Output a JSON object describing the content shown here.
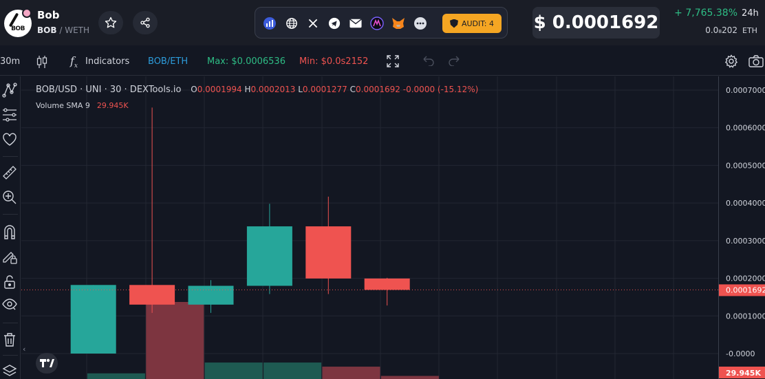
{
  "header": {
    "token_name": "Bob",
    "logo_text": "BOB",
    "base_symbol": "BOB",
    "separator": "/",
    "quote_symbol": "WETH",
    "favorite_icon": "star-icon",
    "share_icon": "share-icon",
    "social_icons": [
      "chart-icon",
      "globe-icon",
      "x-icon",
      "telegram-icon",
      "email-icon",
      "dapp-icon",
      "metamask-icon",
      "more-icon"
    ],
    "audit_label": "AUDIT: 4",
    "price": "$ 0.0001692",
    "change": "+ 7,765.38%",
    "change_period": "24h",
    "eth_price": "0.0₈202",
    "eth_unit": "ETH",
    "colors": {
      "up": "#26a69a",
      "down": "#ef5350",
      "audit": "#f5a623",
      "link": "#2d9cdb"
    }
  },
  "toolbar": {
    "interval": "30m",
    "indicators_label": "Indicators",
    "pair_label": "BOB/ETH",
    "max_label": "Max: $0.0006536",
    "min_label": "Min: $0.0s2152"
  },
  "chart_legend": {
    "title": "BOB/USD · UNI · 30 · DEXTools.io",
    "o_key": "O",
    "o_val": "0.0001994",
    "h_key": "H",
    "h_val": "0.0002013",
    "l_key": "L",
    "l_val": "0.0001277",
    "c_key": "C",
    "c_val": "0.0001692",
    "chg": "-0.0000 (-15.12%)",
    "volume_label": "Volume SMA 9",
    "volume_value": "29.945K"
  },
  "left_tools": [
    "crosshair-icon",
    "trend-line-icon",
    "fib-icon",
    "heart-icon",
    "ruler-icon",
    "zoom-in-icon",
    "magnet-icon",
    "lock-drawing-icon",
    "lock-icon",
    "eye-icon",
    "trash-icon",
    "layers-icon"
  ],
  "chart_data": {
    "type": "candlestick",
    "y_ticks": [
      "0.0007000",
      "0.0006000",
      "0.0005000",
      "0.0004000",
      "0.0003000",
      "0.0002000",
      "0.0001000",
      "-0.0000"
    ],
    "ylim": [
      -1e-05,
      0.00072
    ],
    "current_price_label": "0.0001692",
    "current_price": 0.0001692,
    "volume_axis_label": "29.945K",
    "candles": [
      {
        "o": 0.0,
        "h": 0.0001822,
        "l": 0.0,
        "c": 0.0001822
      },
      {
        "o": 0.0001822,
        "h": 0.0006536,
        "l": 0.000108,
        "c": 0.00013
      },
      {
        "o": 0.00013,
        "h": 0.000195,
        "l": 0.000108,
        "c": 0.00018
      },
      {
        "o": 0.00018,
        "h": 0.000398,
        "l": 0.000158,
        "c": 0.000338
      },
      {
        "o": 0.000338,
        "h": 0.000417,
        "l": 0.000158,
        "c": 0.0001994
      },
      {
        "o": 0.0001994,
        "h": 0.0002013,
        "l": 0.0001277,
        "c": 0.0001692
      }
    ],
    "volumes": [
      2.2,
      29.945,
      6.4,
      6.4,
      4.8,
      1.2
    ],
    "volume_max": 29.945
  }
}
